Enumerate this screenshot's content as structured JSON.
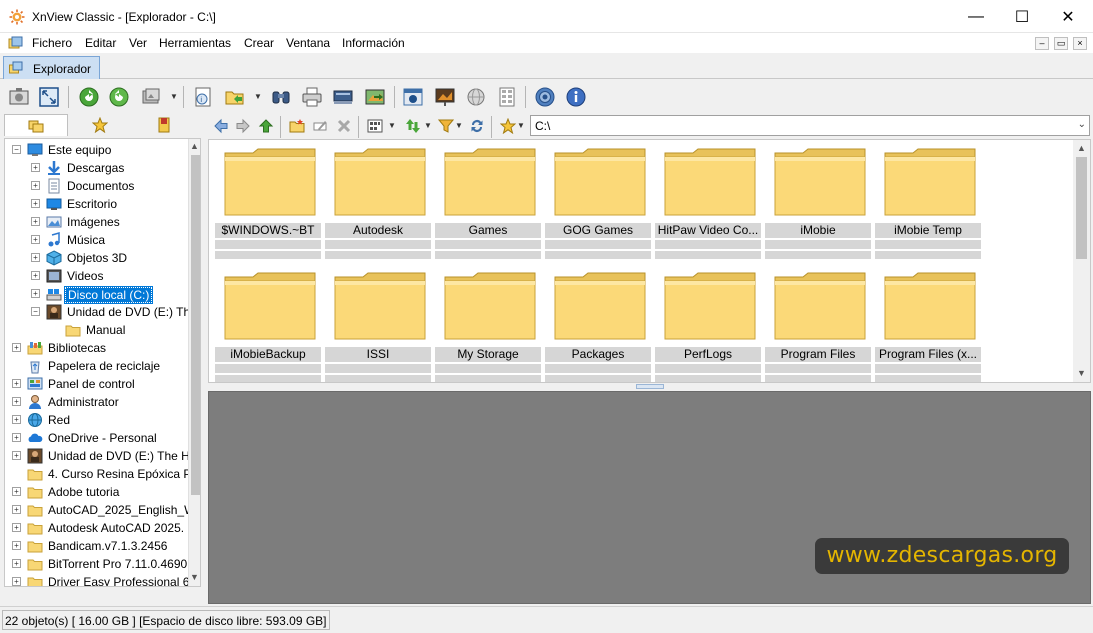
{
  "window": {
    "title": "XnView Classic - [Explorador - C:\\]",
    "controls": {
      "minimize": "—",
      "maximize": "☐",
      "close": "✕"
    }
  },
  "menu": {
    "items": [
      "Fichero",
      "Editar",
      "Ver",
      "Herramientas",
      "Crear",
      "Ventana",
      "Información"
    ],
    "mdi": {
      "minimize": "–",
      "restore": "▭",
      "close": "×"
    }
  },
  "tab": {
    "label": "Explorador"
  },
  "toolbar": {
    "icons": [
      "fullscreen-view-icon",
      "fit-window-icon",
      "refresh-icon",
      "reload-icon",
      "slideshow-icon",
      "properties-icon",
      "open-icon",
      "find-icon",
      "print-icon",
      "scanner-icon",
      "convert-icon",
      "capture-icon",
      "slideshow-screen-icon",
      "web-page-icon",
      "contact-sheet-icon",
      "settings-icon",
      "about-icon"
    ]
  },
  "left_tabs": [
    "folders-icon",
    "favorites-icon",
    "categories-icon"
  ],
  "tree": {
    "items": [
      {
        "label": "Este equipo",
        "icon": "computer-icon",
        "level": 0,
        "expander": "−"
      },
      {
        "label": "Descargas",
        "icon": "downloads-icon",
        "level": 1,
        "expander": "+"
      },
      {
        "label": "Documentos",
        "icon": "documents-icon",
        "level": 1,
        "expander": "+"
      },
      {
        "label": "Escritorio",
        "icon": "desktop-icon",
        "level": 1,
        "expander": "+"
      },
      {
        "label": "Imágenes",
        "icon": "pictures-icon",
        "level": 1,
        "expander": "+"
      },
      {
        "label": "Música",
        "icon": "music-icon",
        "level": 1,
        "expander": "+"
      },
      {
        "label": "Objetos 3D",
        "icon": "objects-3d-icon",
        "level": 1,
        "expander": "+"
      },
      {
        "label": "Videos",
        "icon": "videos-icon",
        "level": 1,
        "expander": "+"
      },
      {
        "label": "Disco local (C:)",
        "icon": "drive-icon",
        "level": 1,
        "expander": "+",
        "selected": true
      },
      {
        "label": "Unidad de DVD (E:) Th",
        "icon": "dvd-icon",
        "level": 1,
        "expander": "−"
      },
      {
        "label": "Manual",
        "icon": "folder-icon",
        "level": 2,
        "expander": ""
      },
      {
        "label": "Bibliotecas",
        "icon": "libraries-icon",
        "level": 0,
        "expander": "+"
      },
      {
        "label": "Papelera de reciclaje",
        "icon": "recycle-bin-icon",
        "level": 0,
        "expander": ""
      },
      {
        "label": "Panel de control",
        "icon": "control-panel-icon",
        "level": 0,
        "expander": "+"
      },
      {
        "label": "Administrator",
        "icon": "user-icon",
        "level": 0,
        "expander": "+"
      },
      {
        "label": "Red",
        "icon": "network-icon",
        "level": 0,
        "expander": "+"
      },
      {
        "label": "OneDrive - Personal",
        "icon": "onedrive-icon",
        "level": 0,
        "expander": "+"
      },
      {
        "label": "Unidad de DVD (E:) The H",
        "icon": "dvd-icon",
        "level": 0,
        "expander": "+"
      },
      {
        "label": "4. Curso Resina Epóxica P",
        "icon": "folder-icon",
        "level": 0,
        "expander": ""
      },
      {
        "label": "Adobe tutoria",
        "icon": "folder-icon",
        "level": 0,
        "expander": "+"
      },
      {
        "label": "AutoCAD_2025_English_W",
        "icon": "folder-icon",
        "level": 0,
        "expander": "+"
      },
      {
        "label": "Autodesk AutoCAD 2025.",
        "icon": "folder-icon",
        "level": 0,
        "expander": "+"
      },
      {
        "label": "Bandicam.v7.1.3.2456",
        "icon": "folder-icon",
        "level": 0,
        "expander": "+"
      },
      {
        "label": "BitTorrent Pro 7.11.0.4690",
        "icon": "folder-icon",
        "level": 0,
        "expander": "+"
      },
      {
        "label": "Driver Easy Professional 6",
        "icon": "folder-icon",
        "level": 0,
        "expander": "+"
      }
    ]
  },
  "path": {
    "value": "C:\\"
  },
  "browser": {
    "items": [
      "$WINDOWS.~BT",
      "Autodesk",
      "Games",
      "GOG Games",
      "HitPaw Video Co...",
      "iMobie",
      "iMobie Temp",
      "iMobieBackup",
      "ISSI",
      "My Storage",
      "Packages",
      "PerfLogs",
      "Program Files",
      "Program Files (x..."
    ]
  },
  "preview": {
    "watermark": "www.zdescargas.org"
  },
  "status": {
    "text": "22 objeto(s) [ 16.00 GB ] [Espacio de disco libre: 593.09 GB]"
  },
  "colors": {
    "selection": "#0078d7",
    "folder": "#f8d775",
    "preview_bg": "#7d7d7d",
    "watermark_text": "#e4b500"
  }
}
